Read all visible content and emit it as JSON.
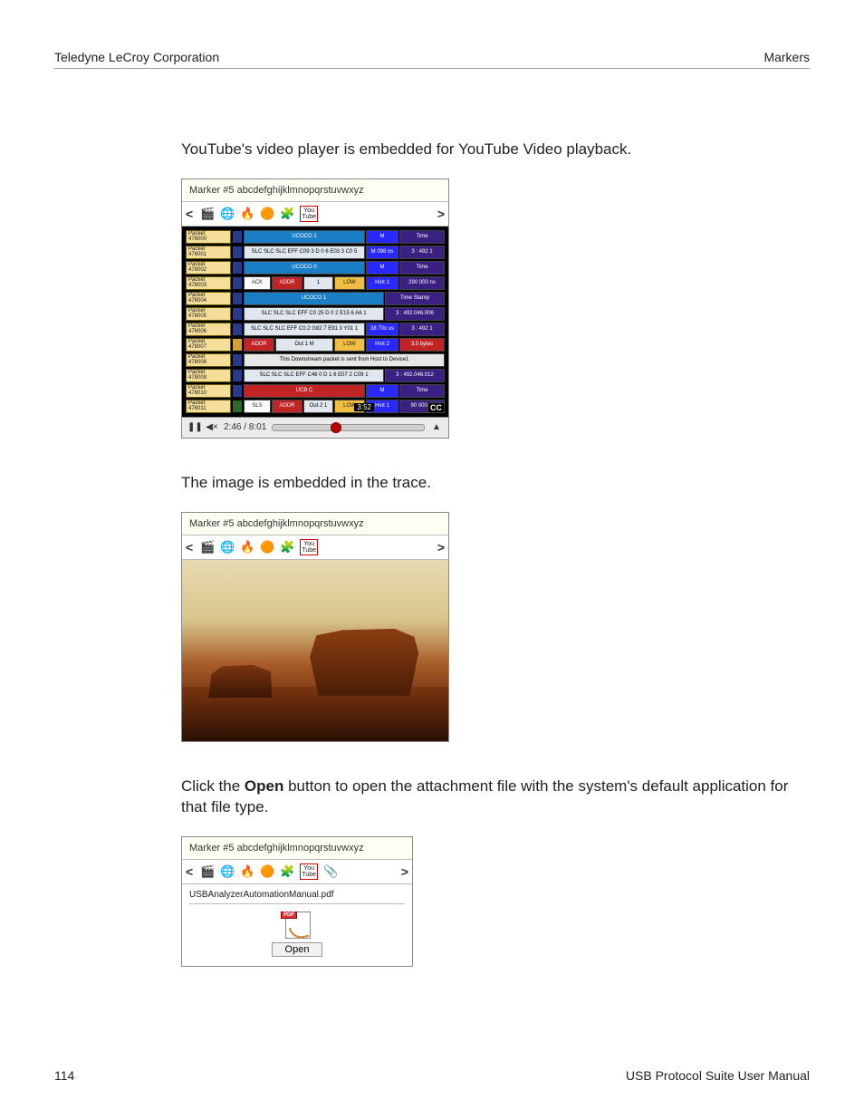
{
  "header": {
    "left": "Teledyne LeCroy Corporation",
    "right": "Markers"
  },
  "paragraphs": {
    "p1": "YouTube's video player is embedded for YouTube Video playback.",
    "p2": "The image is embedded in the trace.",
    "p3_before": "Click the ",
    "p3_bold": "Open",
    "p3_after": " button to open the attachment file with the system's default application for that file type."
  },
  "marker_title": "Marker #5 abcdefghijklmnopqrstuvwxyz",
  "video": {
    "position": "2:46 / 8:01",
    "overlay_time": "3:52",
    "cc": "CC"
  },
  "file": {
    "name": "USBAnalyzerAutomationManual.pdf",
    "open_label": "Open",
    "badge": "PDF"
  },
  "footer": {
    "page": "114",
    "title": "USB Protocol Suite User Manual"
  },
  "toolbar_arrows": {
    "left": "<",
    "right": ">"
  },
  "player_icons": {
    "pause": "❚❚",
    "mute": "◀×",
    "expand": "▲"
  }
}
